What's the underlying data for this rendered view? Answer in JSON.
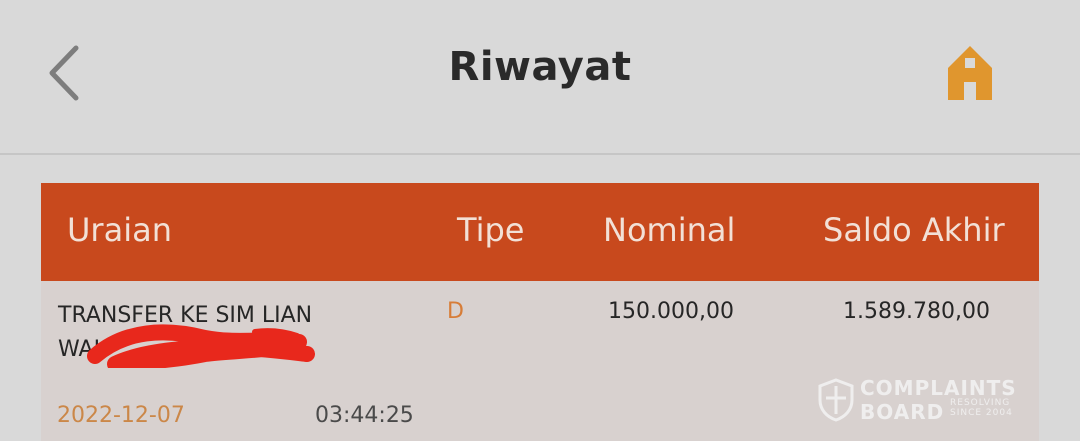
{
  "header": {
    "title": "Riwayat",
    "back_icon": "chevron-left-icon",
    "home_icon": "home-icon",
    "accent_color": "#e0962e"
  },
  "table": {
    "header_color": "#c8491d",
    "columns": [
      "Uraian",
      "Tipe",
      "Nominal",
      "Saldo Akhir"
    ],
    "rows": [
      {
        "uraian_line1": "TRANSFER KE SIM LIAN",
        "uraian_line2": "WAH",
        "tipe": "D",
        "nominal": "150.000,00",
        "saldo_akhir": "1.589.780,00",
        "date": "2022-12-07",
        "time": "03:44:25"
      }
    ]
  },
  "watermark": {
    "line1": "COMPLAINTS",
    "line2": "BOARD",
    "tag1": "RESOLVING",
    "tag2": "SINCE 2004"
  }
}
